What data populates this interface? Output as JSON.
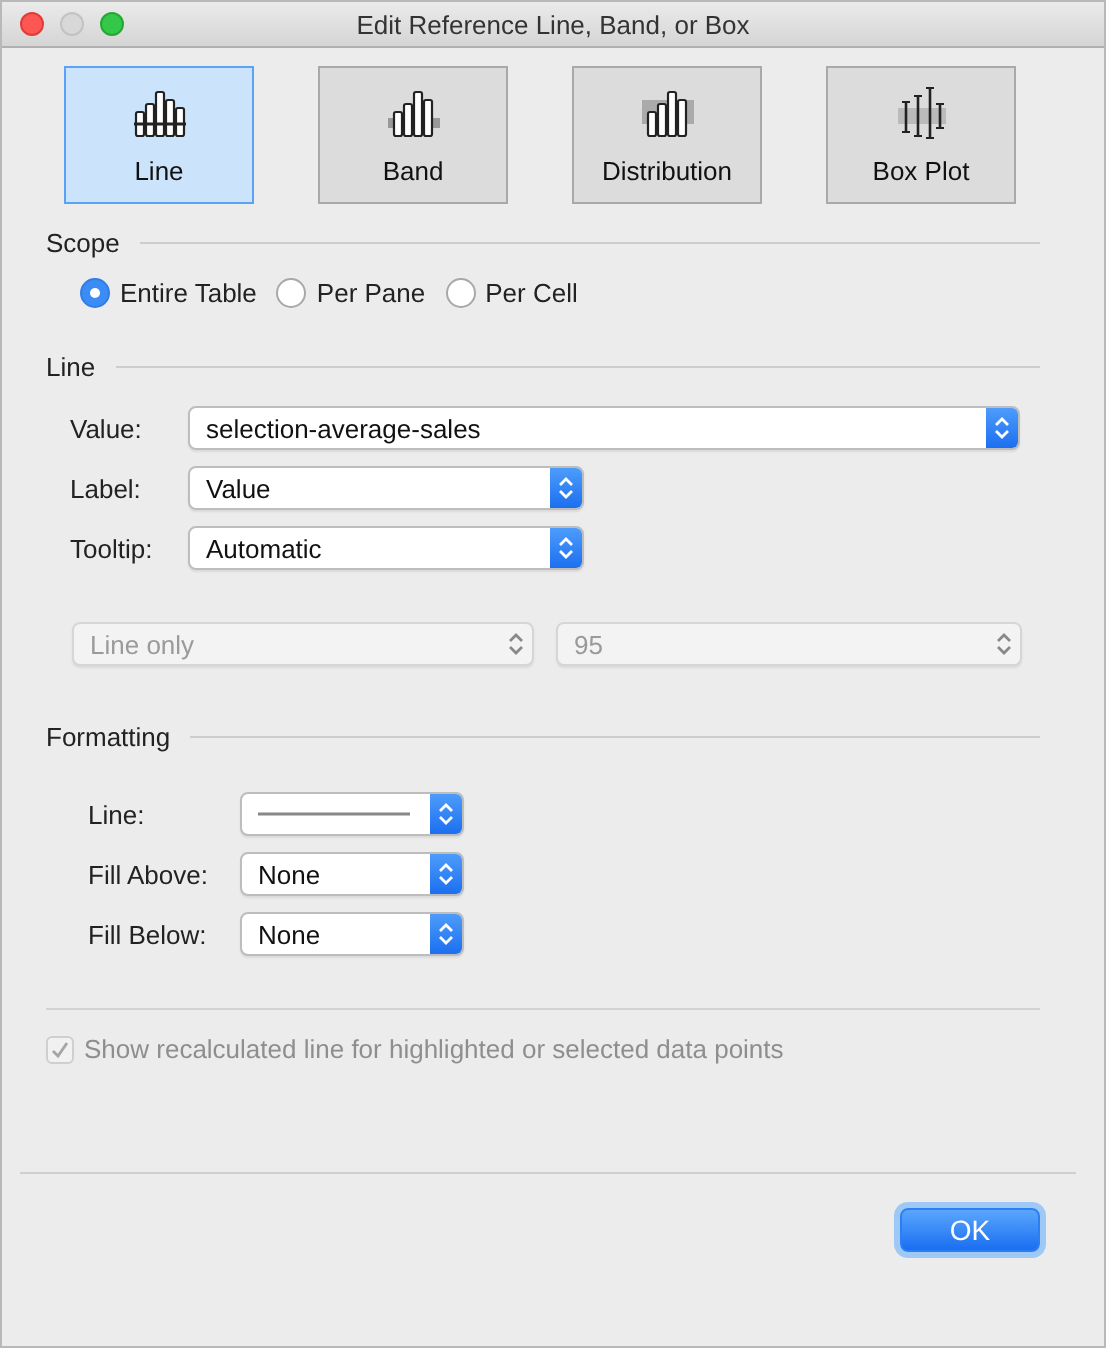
{
  "window": {
    "title": "Edit Reference Line, Band, or Box"
  },
  "types": [
    {
      "label": "Line",
      "kind": "line",
      "selected": true
    },
    {
      "label": "Band",
      "kind": "band",
      "selected": false
    },
    {
      "label": "Distribution",
      "kind": "distribution",
      "selected": false
    },
    {
      "label": "Box Plot",
      "kind": "boxplot",
      "selected": false
    }
  ],
  "scope": {
    "heading": "Scope",
    "options": [
      {
        "label": "Entire Table",
        "selected": true
      },
      {
        "label": "Per Pane",
        "selected": false
      },
      {
        "label": "Per Cell",
        "selected": false
      }
    ]
  },
  "line": {
    "heading": "Line",
    "fields": [
      {
        "label": "Value:",
        "value": "selection-average-sales",
        "wide": true
      },
      {
        "label": "Label:",
        "value": "Value",
        "wide": false
      },
      {
        "label": "Tooltip:",
        "value": "Automatic",
        "wide": false
      }
    ],
    "options": [
      {
        "value": "Line only",
        "disabled": true
      },
      {
        "value": "95",
        "disabled": true
      }
    ]
  },
  "formatting": {
    "heading": "Formatting",
    "fields": [
      {
        "label": "Line:",
        "kind": "line-style"
      },
      {
        "label": "Fill Above:",
        "kind": "text",
        "value": "None"
      },
      {
        "label": "Fill Below:",
        "kind": "text",
        "value": "None"
      }
    ]
  },
  "recalc": {
    "label": "Show recalculated line for highlighted or selected data points",
    "checked": true,
    "disabled": true
  },
  "buttons": [
    {
      "label": "OK",
      "default": true
    }
  ]
}
